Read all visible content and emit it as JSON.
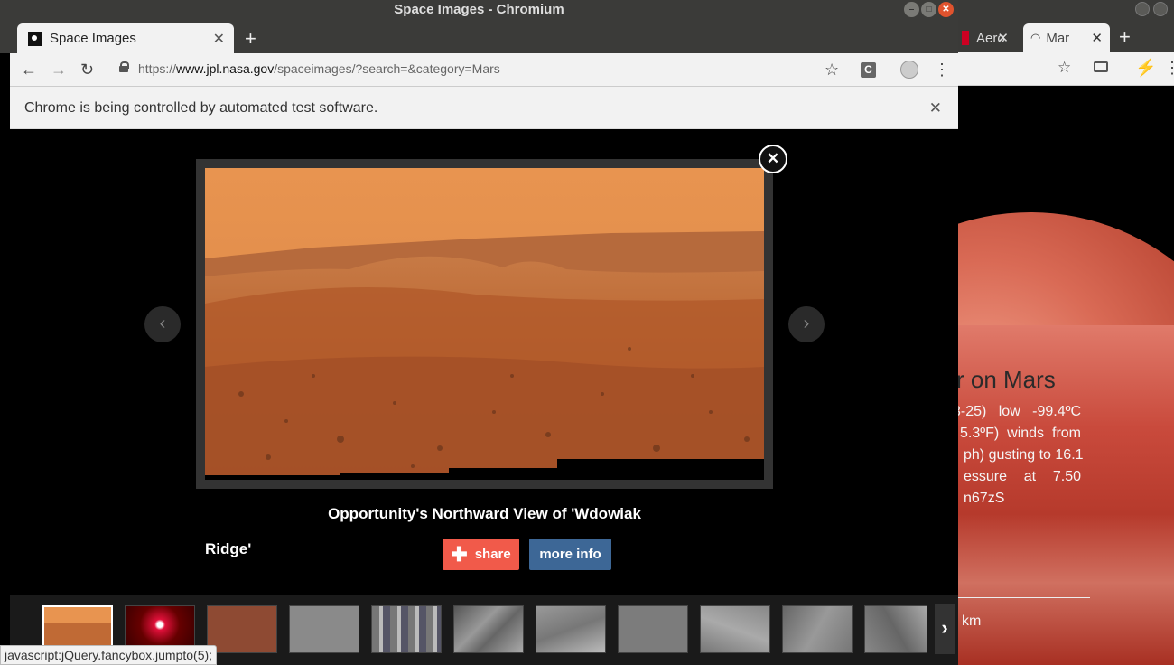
{
  "window": {
    "title": "Space Images - Chromium"
  },
  "tab": {
    "title": "Space Images",
    "close": "✕",
    "new_tab": "+"
  },
  "toolbar": {
    "url_scheme": "https://",
    "url_host": "www.jpl.nasa.gov",
    "url_path": "/spaceimages/?search=&category=Mars",
    "extension_label": "C"
  },
  "infobar": {
    "message": "Chrome is being controlled by automated test software.",
    "close": "✕"
  },
  "fancybox": {
    "close": "✕",
    "caption_line1": "Opportunity's Northward View of 'Wdowiak",
    "caption_line2": "Ridge'",
    "share_label": "share",
    "more_info_label": "more info",
    "prev": "‹",
    "next": "›",
    "thumb_next": "›"
  },
  "status": {
    "text": "javascript:jQuery.fancybox.jumpto(5);"
  },
  "background_window": {
    "tabs": [
      {
        "title": "Aero",
        "close": "✕"
      },
      {
        "title": "Mar",
        "close": "✕"
      }
    ],
    "new_tab": "+",
    "heading": "r on Mars",
    "lines": [
      [
        "3-25)",
        "low",
        "-99.4ºC"
      ],
      [
        "5.3ºF)",
        "winds",
        "from"
      ],
      [
        "ph) gusting to 16.1"
      ],
      [
        "essure",
        "at",
        "7.50"
      ],
      [
        "n67zS"
      ]
    ],
    "km": "km"
  },
  "colors": {
    "share": "#f15a4a",
    "more_info": "#3d6796",
    "close_window": "#e0532e",
    "mars_sky": "#e89450",
    "mars_ground": "#b8612e"
  }
}
